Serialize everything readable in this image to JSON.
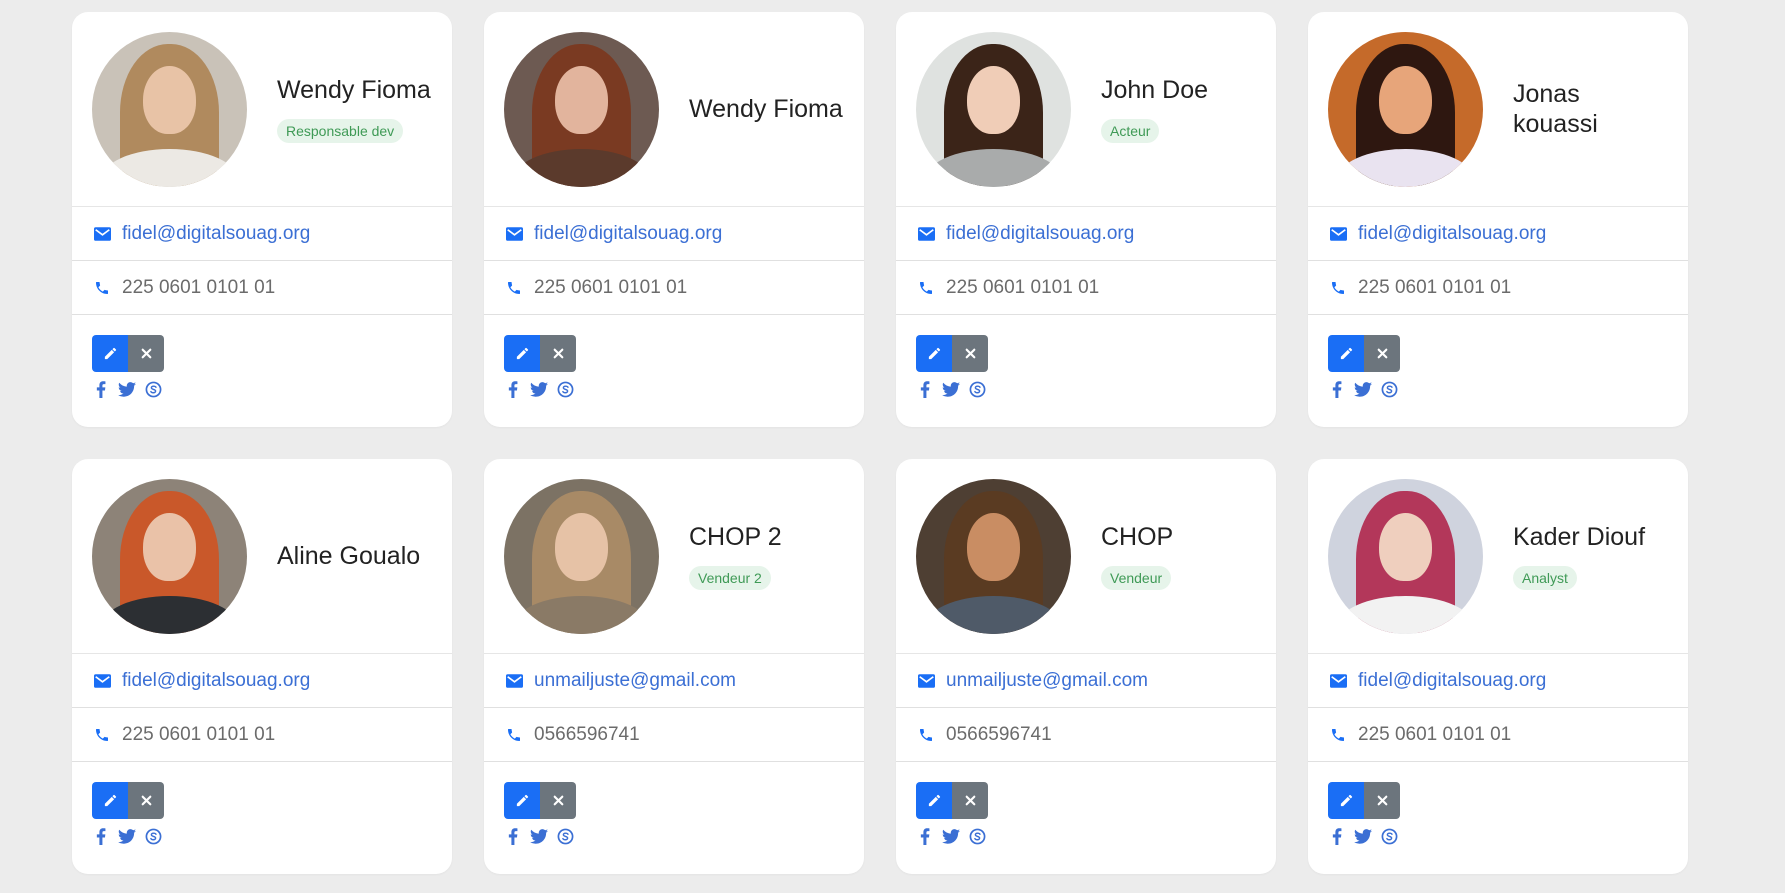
{
  "cards": [
    {
      "name": "Wendy Fioma",
      "role": "Responsable dev",
      "email": "fidel@digitalsouag.org",
      "phone": "225 0601 0101 01",
      "avatar": {
        "bg": "#c9c2b8",
        "hair": "#b08a5e",
        "skin": "#e8c3a6",
        "clothes": "#ece9e4"
      }
    },
    {
      "name": "Wendy Fioma",
      "role": "",
      "email": "fidel@digitalsouag.org",
      "phone": "225 0601 0101 01",
      "avatar": {
        "bg": "#6d5a52",
        "hair": "#7a3a22",
        "skin": "#e2b49d",
        "clothes": "#5b3a2c"
      }
    },
    {
      "name": "John Doe",
      "role": "Acteur",
      "email": "fidel@digitalsouag.org",
      "phone": "225 0601 0101 01",
      "avatar": {
        "bg": "#dfe2e0",
        "hair": "#3b2418",
        "skin": "#f0cdb7",
        "clothes": "#a9abab"
      }
    },
    {
      "name": "Jonas kouassi",
      "role": "",
      "email": "fidel@digitalsouag.org",
      "phone": "225 0601 0101 01",
      "avatar": {
        "bg": "#c56a2a",
        "hair": "#2e1710",
        "skin": "#e7a57a",
        "clothes": "#e9e3f0"
      }
    },
    {
      "name": "Aline Goualo",
      "role": "",
      "email": "fidel@digitalsouag.org",
      "phone": "225 0601 0101 01",
      "avatar": {
        "bg": "#8d8378",
        "hair": "#c9582a",
        "skin": "#eac2a8",
        "clothes": "#2c2f33"
      }
    },
    {
      "name": "CHOP 2",
      "role": "Vendeur 2",
      "email": "unmailjuste@gmail.com",
      "phone": "0566596741",
      "avatar": {
        "bg": "#7c7264",
        "hair": "#a88a66",
        "skin": "#e6c2a6",
        "clothes": "#8a7a66"
      }
    },
    {
      "name": "CHOP",
      "role": "Vendeur",
      "email": "unmailjuste@gmail.com",
      "phone": "0566596741",
      "avatar": {
        "bg": "#4e3f33",
        "hair": "#5a3b22",
        "skin": "#c98d63",
        "clothes": "#4f5a68"
      }
    },
    {
      "name": "Kader Diouf",
      "role": "Analyst",
      "email": "fidel@digitalsouag.org",
      "phone": "225 0601 0101 01",
      "avatar": {
        "bg": "#cfd3de",
        "hair": "#b3375a",
        "skin": "#efcfbe",
        "clothes": "#f2f2f2"
      }
    }
  ],
  "icons": {
    "email": "mail-icon",
    "phone": "phone-icon",
    "edit": "pencil-icon",
    "delete": "close-icon",
    "social": [
      "facebook-icon",
      "twitter-icon",
      "skype-icon"
    ]
  },
  "colors": {
    "accent": "#1a6ef5",
    "badge_bg": "#e6f4ea",
    "badge_text": "#3f9a56",
    "link": "#3b6fd4"
  }
}
